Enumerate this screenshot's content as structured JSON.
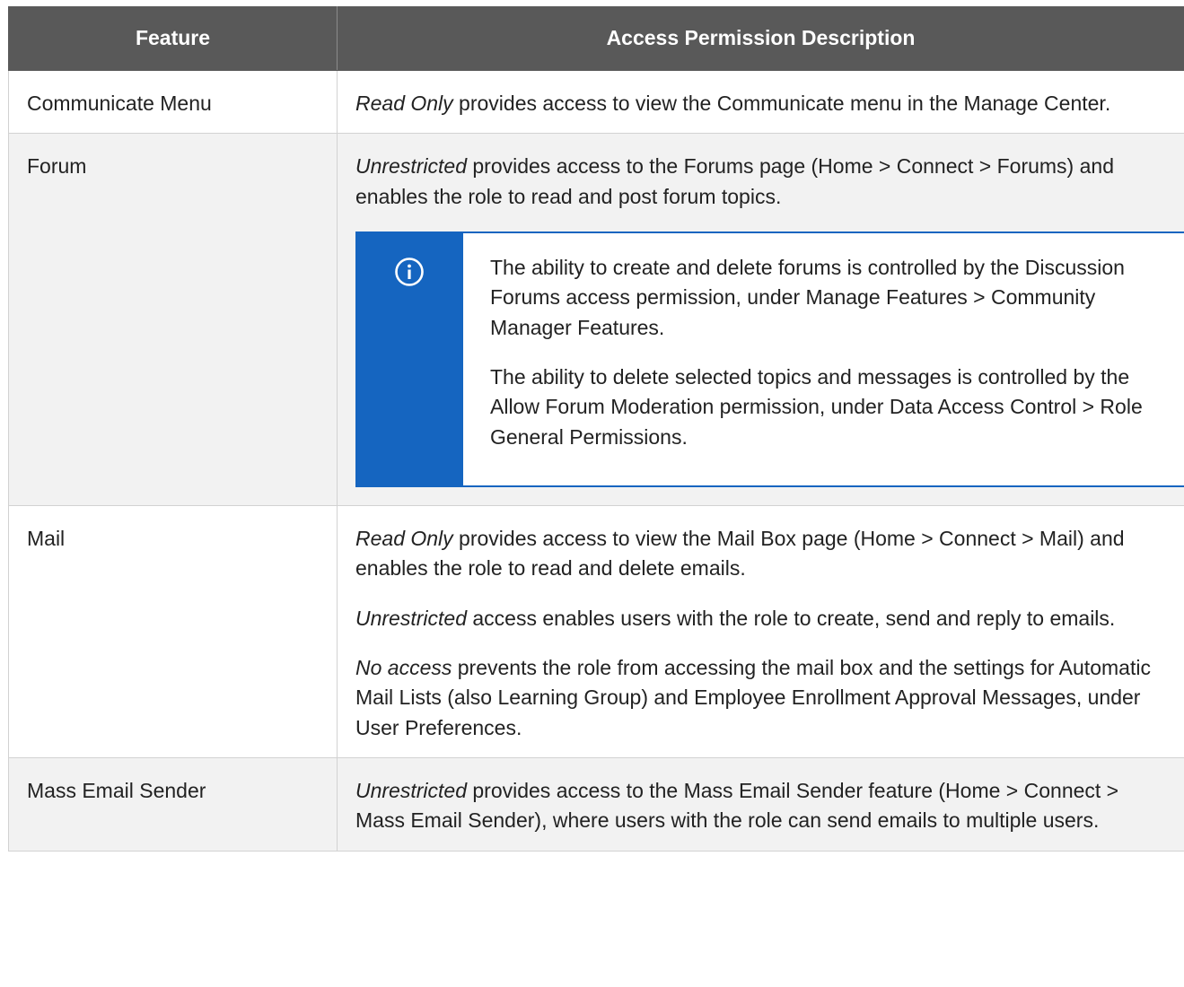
{
  "header": {
    "feature": "Feature",
    "description": "Access Permission Description"
  },
  "rows": [
    {
      "feature": "Communicate Menu",
      "paragraphs": [
        {
          "em": "Read Only",
          "text": " provides access to view the Communicate menu in the Manage Center."
        }
      ]
    },
    {
      "feature": "Forum",
      "paragraphs": [
        {
          "em": "Unrestricted",
          "text": " provides access to the Forums page (Home > Connect > Forums) and enables the role to read and post forum topics."
        }
      ],
      "note": {
        "icon": "info-icon",
        "paragraphs": [
          "The ability to create and delete forums is controlled by the Discussion Forums access permission, under Manage Features > Community Manager Features.",
          "The ability to delete selected topics and messages is controlled by the Allow Forum Moderation permission, under Data Access Control > Role General Permissions."
        ]
      }
    },
    {
      "feature": "Mail",
      "paragraphs": [
        {
          "em": "Read Only",
          "text": " provides access to view the Mail Box page (Home > Connect > Mail) and enables the role to read and delete emails."
        },
        {
          "em": "Unrestricted",
          "text": " access enables users with the role to create, send and reply to emails."
        },
        {
          "em": "No access",
          "text": " prevents the role from accessing the mail box and the settings for Automatic Mail Lists (also Learning Group) and Employee Enrollment Approval Messages, under User Preferences."
        }
      ]
    },
    {
      "feature": "Mass Email Sender",
      "paragraphs": [
        {
          "em": "Unrestricted",
          "text": " provides access to the Mass Email Sender feature (Home > Connect > Mass Email Sender), where users with the role can send emails to multiple users."
        }
      ]
    }
  ],
  "colors": {
    "header_bg": "#595959",
    "note_accent": "#1565c0",
    "shaded_row": "#f2f2f2"
  }
}
